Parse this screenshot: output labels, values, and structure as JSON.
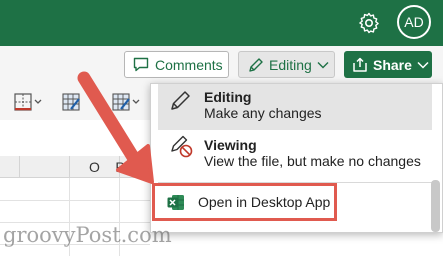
{
  "header": {
    "avatar_initials": "AD",
    "gear_icon": "gear-icon",
    "brand_color": "#1e7145"
  },
  "toolbar": {
    "comments_label": "Comments",
    "editing_label": "Editing",
    "share_label": "Share"
  },
  "grid": {
    "column_headers": [
      "O",
      "P"
    ]
  },
  "mode_menu": {
    "items": [
      {
        "title": "Editing",
        "description": "Make any changes",
        "icon": "pencil-icon",
        "selected": true
      },
      {
        "title": "Viewing",
        "description": "View the file, but make no changes",
        "icon": "pencil-slash-icon",
        "selected": false
      }
    ],
    "open_desktop_label": "Open in Desktop App",
    "open_desktop_icon": "excel-icon",
    "highlight_color": "#e05a4f"
  },
  "watermark": "groovyPost.com"
}
